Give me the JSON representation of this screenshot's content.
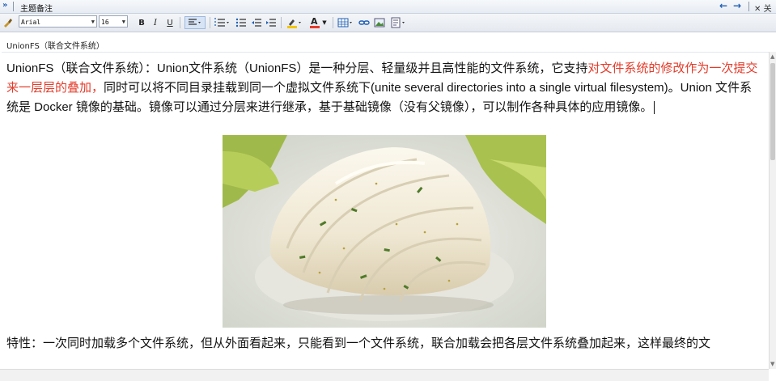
{
  "titlebar": {
    "expand_glyph": "»",
    "title": "主题备注",
    "back_glyph": "←",
    "forward_glyph": "→",
    "close_glyph": "✕",
    "close_label": "关闭"
  },
  "toolbar": {
    "font_name": "Arial",
    "font_size": "16",
    "bold": "B",
    "italic": "I",
    "underline": "U",
    "font_color_glyph": "A"
  },
  "note": {
    "header_label": "UnionFS（联合文件系统）",
    "para1_pre": "UnionFS（联合文件系统）：Union文件系统（UnionFS）是一种分层、轻量级并且高性能的文件系统，它支持",
    "para1_red": "对文件系统的修改作为一次提交来一层层的叠加，",
    "para1_post": "同时可以将不同目录挂载到同一个虚拟文件系统下(unite several directories into a single virtual filesystem)。Union 文件系统是 Docker 镜像的基础。镜像可以通过分层来进行继承，基于基础镜像（没有父镜像），可以制作各种具体的应用镜像。",
    "para2": "特性：一次同时加载多个文件系统，但从外面看起来，只能看到一个文件系统，联合加载会把各层文件系统叠加起来，这样最终的文"
  },
  "colors": {
    "highlight_text": "#e43b2a",
    "accent": "#1f5fb4"
  }
}
